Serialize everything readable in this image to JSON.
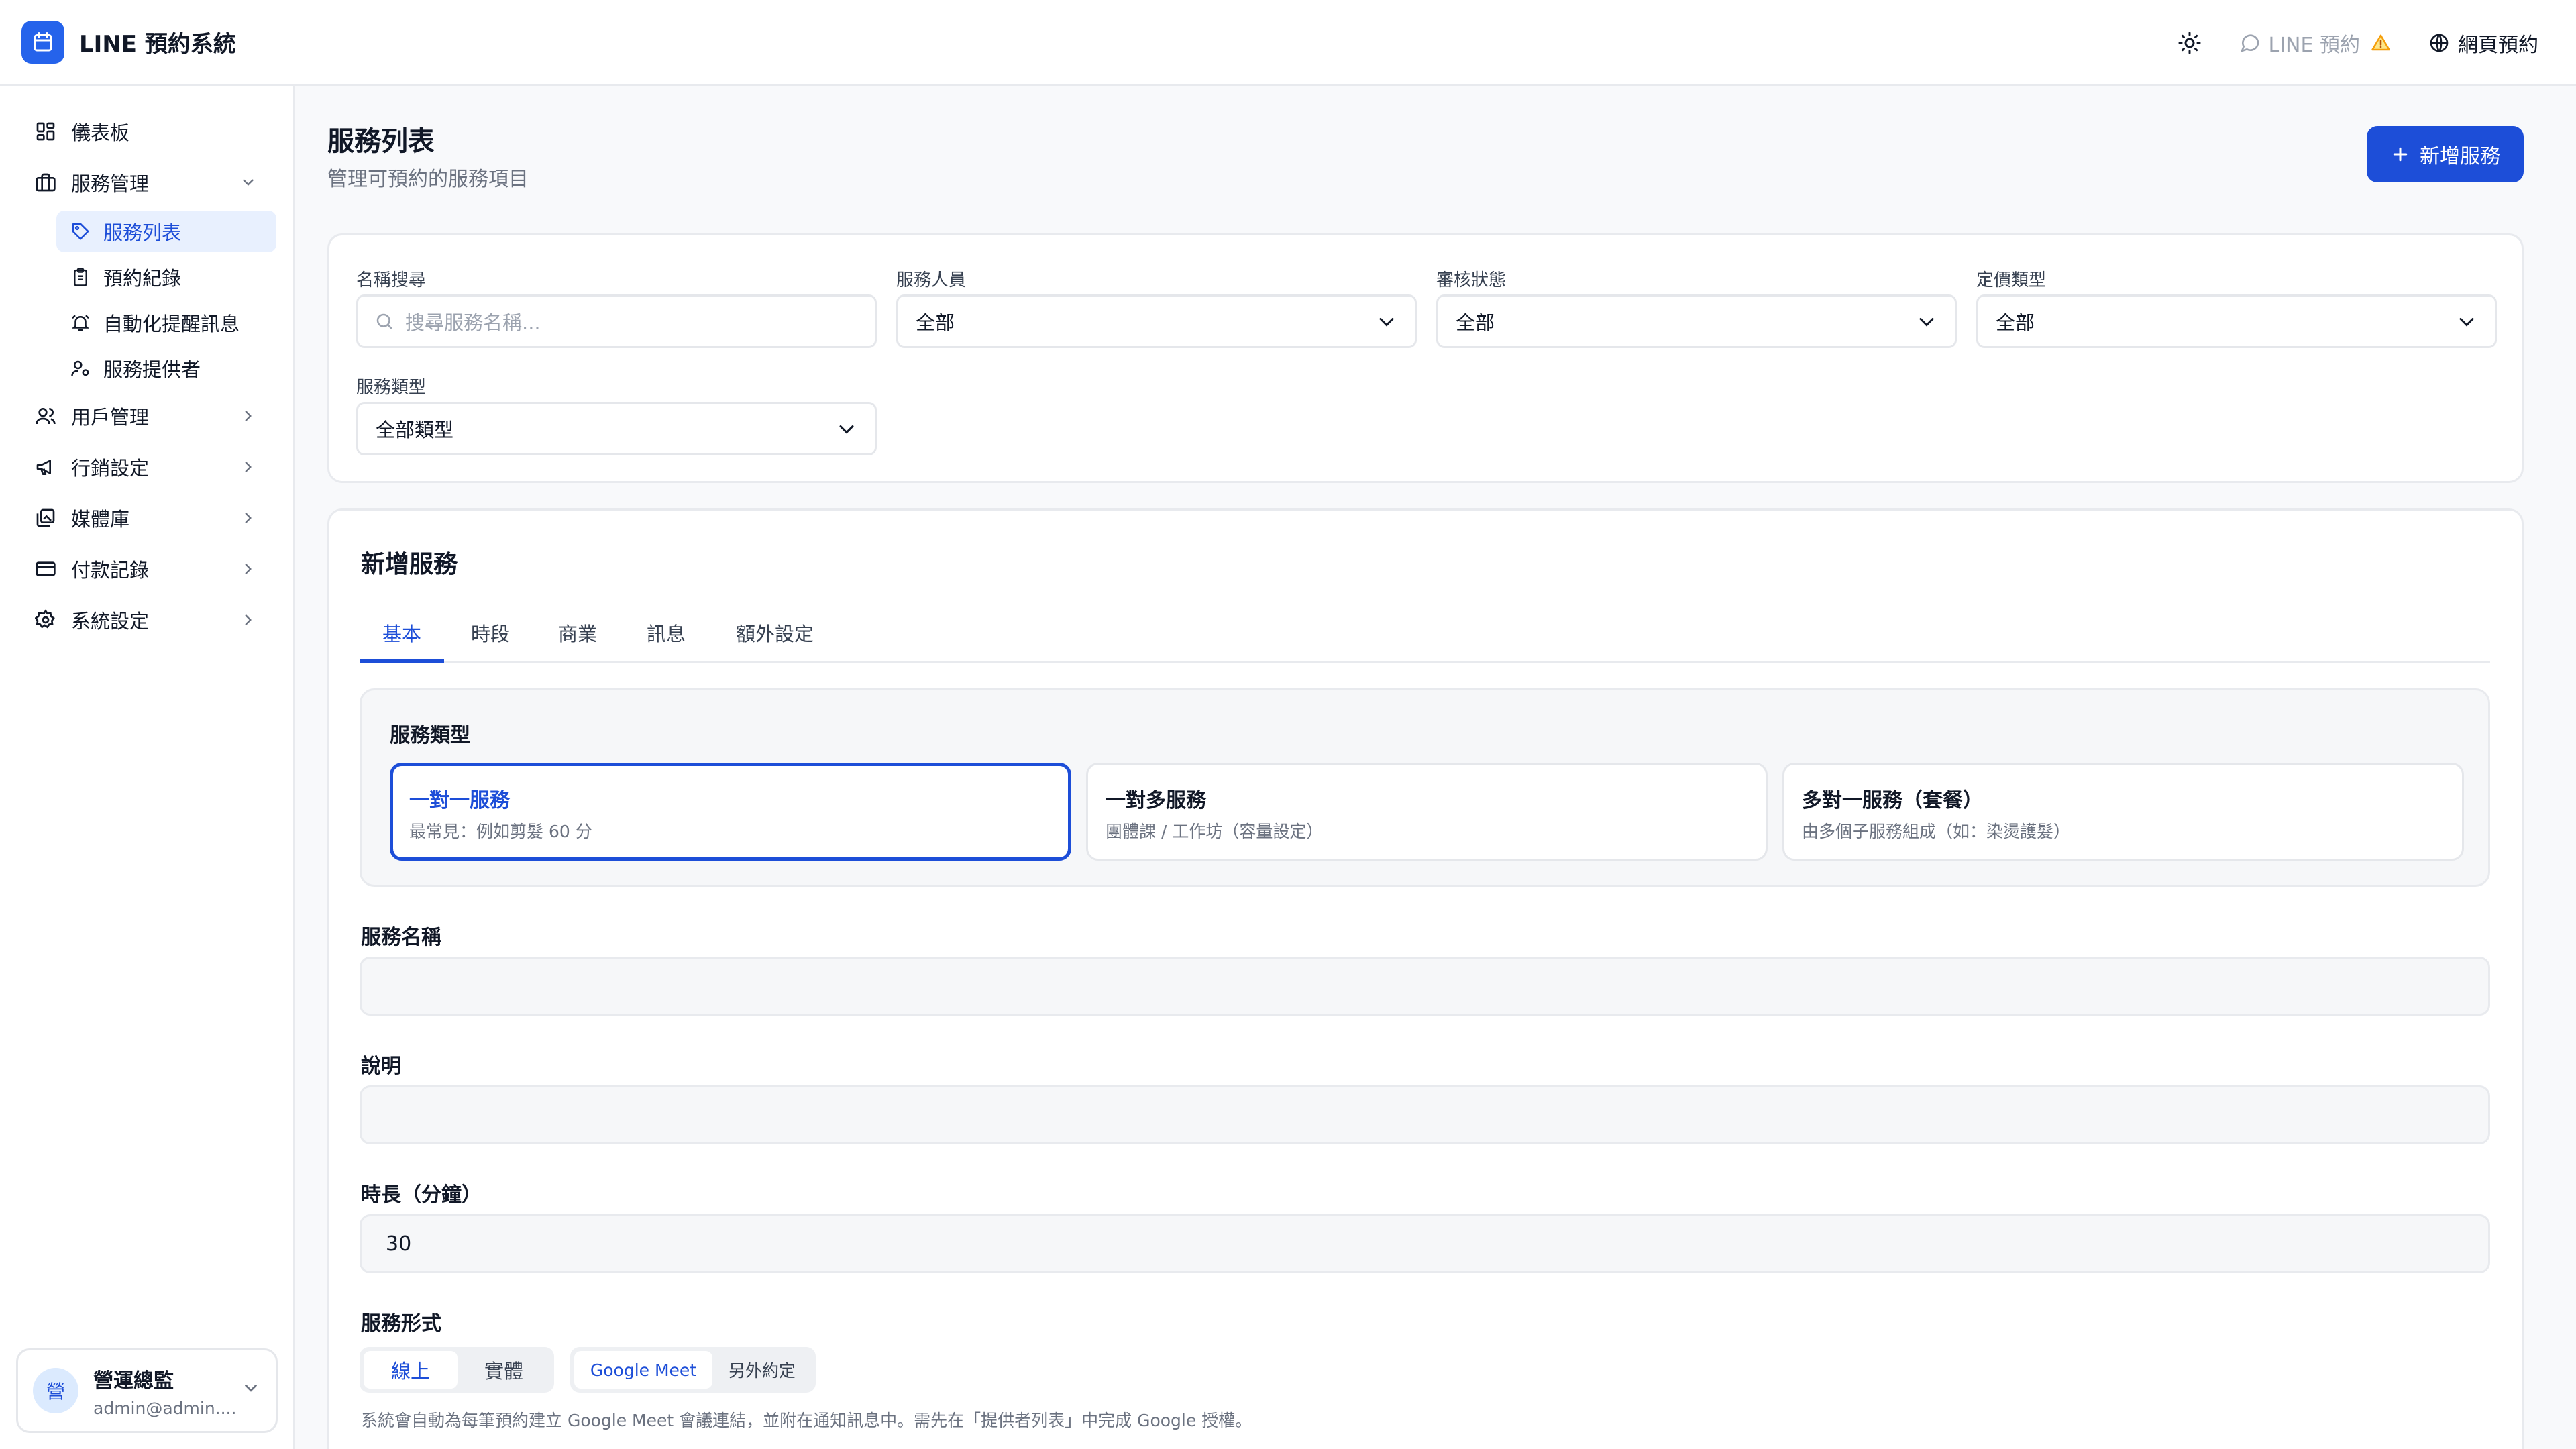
{
  "app": {
    "title": "LINE 預約系統"
  },
  "header": {
    "line_link": "LINE 預約",
    "web_link": "網頁預約"
  },
  "sidebar": {
    "items": [
      {
        "label": "儀表板",
        "icon": "dashboard-icon"
      },
      {
        "label": "服務管理",
        "icon": "briefcase-icon",
        "expanded": true
      },
      {
        "label": "用戶管理",
        "icon": "users-icon"
      },
      {
        "label": "行銷設定",
        "icon": "megaphone-icon"
      },
      {
        "label": "媒體庫",
        "icon": "gallery-icon"
      },
      {
        "label": "付款記錄",
        "icon": "credit-card-icon"
      },
      {
        "label": "系統設定",
        "icon": "gear-icon"
      }
    ],
    "subitems": [
      {
        "label": "服務列表",
        "icon": "tag-icon",
        "active": true
      },
      {
        "label": "預約紀錄",
        "icon": "clipboard-icon"
      },
      {
        "label": "自動化提醒訊息",
        "icon": "bell-icon"
      },
      {
        "label": "服務提供者",
        "icon": "user-settings-icon"
      }
    ],
    "user": {
      "avatar": "營",
      "name": "營運總監",
      "email": "admin@admin...."
    }
  },
  "page": {
    "title": "服務列表",
    "subtitle": "管理可預約的服務項目",
    "add_button": "新增服務"
  },
  "filters": {
    "name_label": "名稱搜尋",
    "name_placeholder": "搜尋服務名稱...",
    "staff_label": "服務人員",
    "staff_value": "全部",
    "review_label": "審核狀態",
    "review_value": "全部",
    "pricing_label": "定價類型",
    "pricing_value": "全部",
    "type_label": "服務類型",
    "type_value": "全部類型"
  },
  "form": {
    "title": "新增服務",
    "tabs": [
      "基本",
      "時段",
      "商業",
      "訊息",
      "額外設定"
    ],
    "active_tab": "基本",
    "service_type_label": "服務類型",
    "service_types": [
      {
        "title": "一對一服務",
        "desc": "最常見：例如剪髮 60 分",
        "selected": true
      },
      {
        "title": "一對多服務",
        "desc": "團體課 / 工作坊（容量設定）",
        "selected": false
      },
      {
        "title": "多對一服務（套餐）",
        "desc": "由多個子服務組成（如：染燙護髮）",
        "selected": false
      }
    ],
    "name_label": "服務名稱",
    "name_value": "",
    "desc_label": "說明",
    "desc_value": "",
    "duration_label": "時長（分鐘）",
    "duration_value": "30",
    "mode_label": "服務形式",
    "mode_options": [
      "線上",
      "實體"
    ],
    "mode_selected": "線上",
    "platform_options": [
      "Google Meet",
      "另外約定"
    ],
    "platform_selected": "Google Meet",
    "hint": "系統會自動為每筆預約建立 Google Meet 會議連結，並附在通知訊息中。需先在「提供者列表」中完成 Google 授權。"
  },
  "colors": {
    "accent": "#1d4ed8",
    "warning": "#f59e0b"
  }
}
